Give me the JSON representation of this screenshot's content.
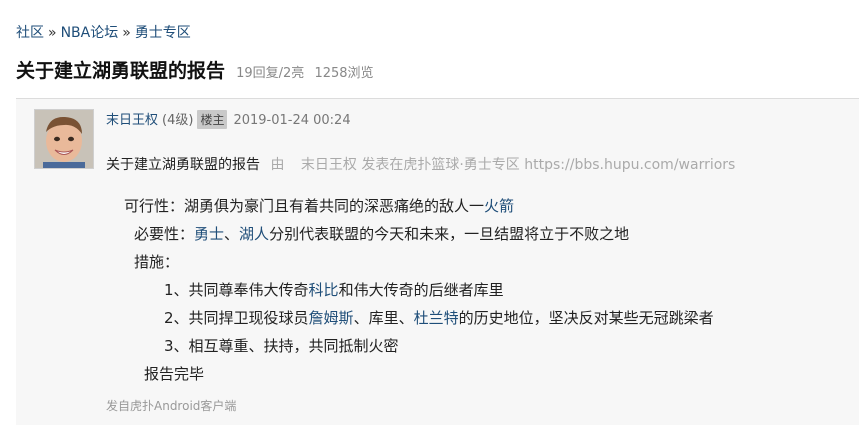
{
  "breadcrumb": {
    "items": [
      "社区",
      "NBA论坛",
      "勇士专区"
    ],
    "separator": "»"
  },
  "thread": {
    "title": "关于建立湖勇联盟的报告",
    "replies": "19回复",
    "lights": "/2亮",
    "views": "1258浏览"
  },
  "post": {
    "author": "末日王权",
    "level": "(4级)",
    "owner_badge": "楼主",
    "time": "2019-01-24 00:24",
    "subject": "关于建立湖勇联盟的报告",
    "source_prefix": "由",
    "source_author": "末日王权",
    "source_text": "发表在虎扑篮球·勇士专区",
    "source_url": "https://bbs.hupu.com/warriors",
    "lines": {
      "l1a": "可行性：湖勇俱为豪门且有着共同的深恶痛绝的敌人",
      "l1b": "一",
      "l1link": "火箭",
      "l2a": "必要性：",
      "l2link1": "勇士",
      "l2sep": "、",
      "l2link2": "湖人",
      "l2b": "分别代表联盟的今天和未来，一旦结盟将立于不败之地",
      "l3": "措施：",
      "l4a": "1、共同尊奉伟大传奇",
      "l4link": "科比",
      "l4b": "和伟大传奇的后继者库里",
      "l5a": "2、共同捍卫现役球员",
      "l5link1": "詹姆斯",
      "l5b": "、库里、",
      "l5link2": "杜兰特",
      "l5c": "的历史地位，坚决反对某些无冠跳梁者",
      "l6": "3、相互尊重、扶持，共同抵制火密",
      "l7": "报告完毕"
    },
    "client": "发自虎扑Android客户端"
  },
  "colors": {
    "link": "#1f4e79",
    "post_bg": "#f7f7f7",
    "meta": "#888888"
  }
}
